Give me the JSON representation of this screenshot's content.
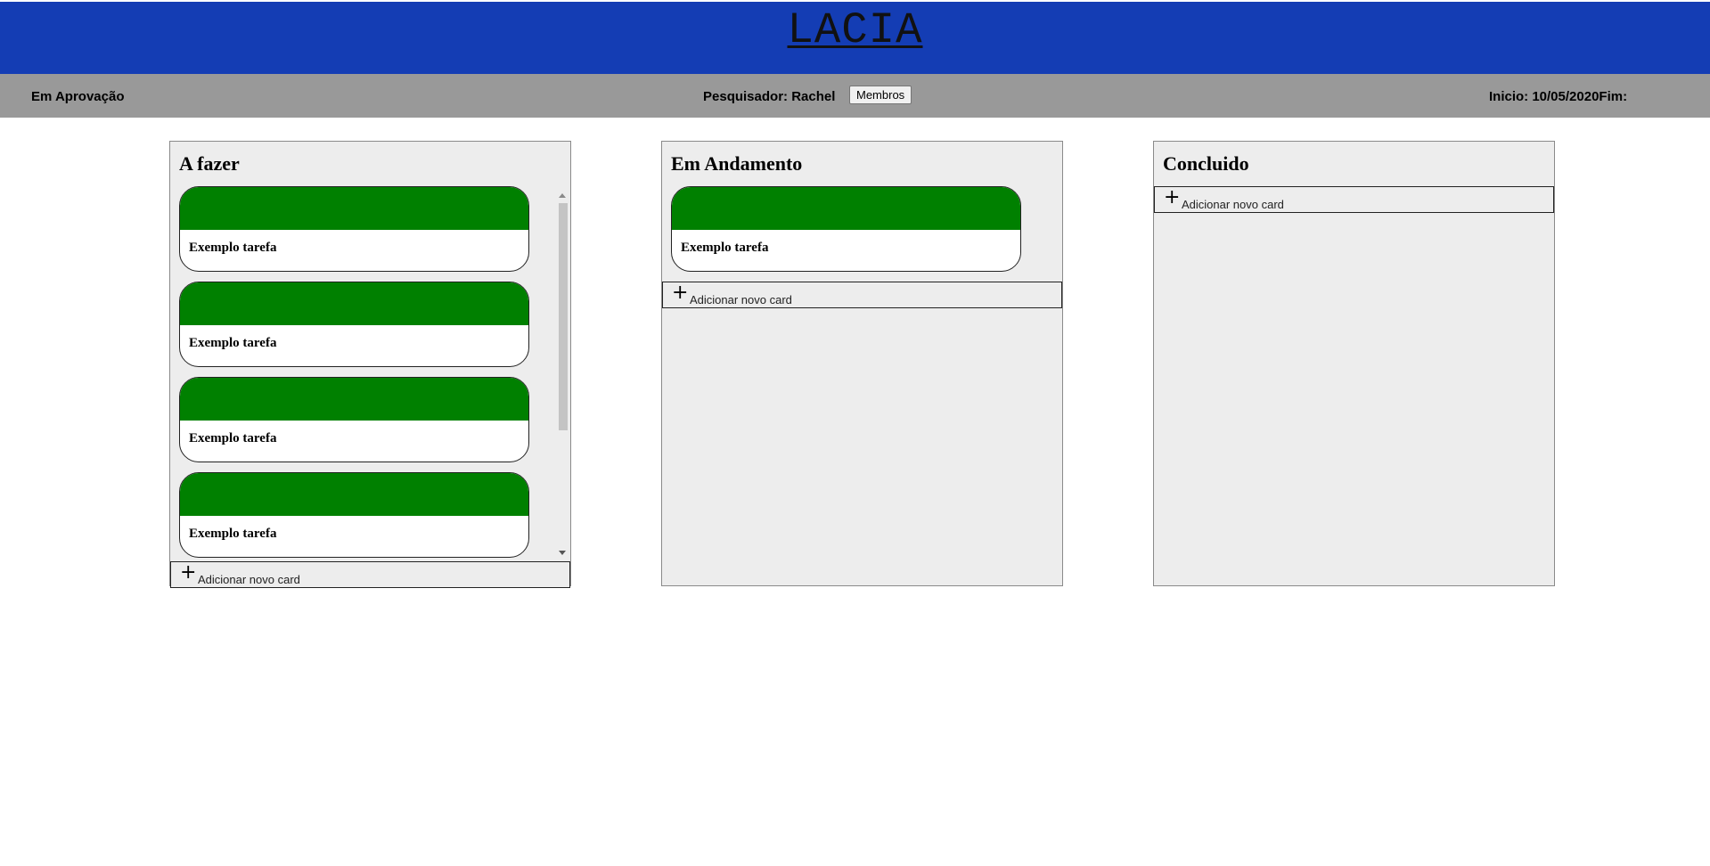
{
  "app": {
    "title": "LACIA"
  },
  "infobar": {
    "status": "Em Aprovação",
    "researcher": "Pesquisador: Rachel",
    "members_button": "Membros",
    "dates": "Inicio: 10/05/2020Fim:"
  },
  "columns": [
    {
      "title": "A fazer",
      "cards": [
        "Exemplo tarefa",
        "Exemplo tarefa",
        "Exemplo tarefa",
        "Exemplo tarefa"
      ],
      "add_label": "Adicionar novo card"
    },
    {
      "title": "Em Andamento",
      "cards": [
        "Exemplo tarefa"
      ],
      "add_label": "Adicionar novo card"
    },
    {
      "title": "Concluido",
      "cards": [],
      "add_label": "Adicionar novo card"
    }
  ],
  "icons": {
    "add": "plus-icon",
    "plus_glyph": "+"
  },
  "colors": {
    "header": "#143db4",
    "infobar": "#999999",
    "card_band": "#008000",
    "column_bg": "#ededed"
  }
}
